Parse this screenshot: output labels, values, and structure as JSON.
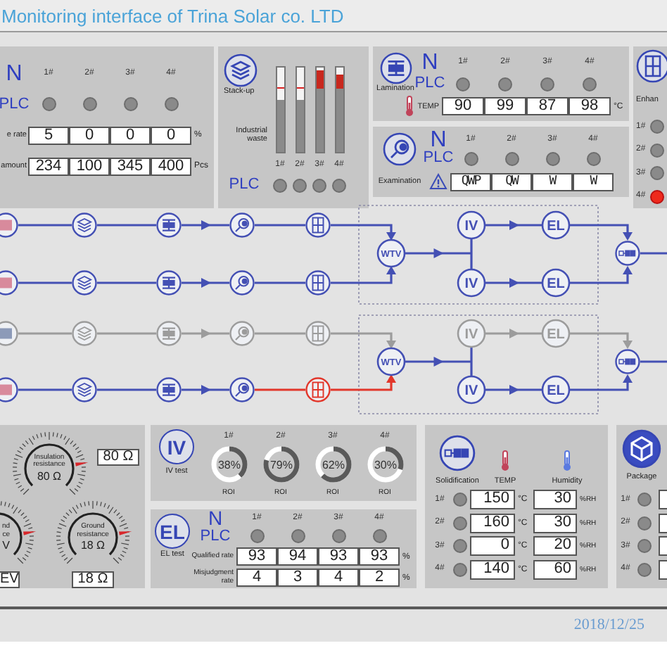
{
  "header": {
    "title": "Monitoring interface of Trina Solar co. LTD"
  },
  "production": {
    "n_label": "N",
    "plc_label": "PLC",
    "stations": [
      {
        "label": "1#",
        "alarm": false
      },
      {
        "label": "2#",
        "alarm": false
      },
      {
        "label": "3#",
        "alarm": false
      },
      {
        "label": "4#",
        "alarm": false
      }
    ],
    "rows": [
      {
        "label": "e rate",
        "values": [
          "5",
          "0",
          "0",
          "0"
        ],
        "unit": "%"
      },
      {
        "label": "amount",
        "values": [
          "234",
          "100",
          "345",
          "400"
        ],
        "unit": "Pcs"
      }
    ]
  },
  "stack_up": {
    "label": "Stack-up",
    "waste_label": "Industrial waste",
    "bins": [
      {
        "label": "1#",
        "level": 0.62
      },
      {
        "label": "2#",
        "level": 0.62
      },
      {
        "label": "3#",
        "level": 0.97
      },
      {
        "label": "4#",
        "level": 0.92
      }
    ],
    "plc_label": "PLC",
    "stations": [
      {
        "alarm": false
      },
      {
        "alarm": false
      },
      {
        "alarm": false
      },
      {
        "alarm": false
      }
    ]
  },
  "lamination": {
    "label": "Lamination",
    "n_label": "N",
    "plc_label": "PLC",
    "stations": [
      {
        "label": "1#",
        "alarm": false
      },
      {
        "label": "2#",
        "alarm": false
      },
      {
        "label": "3#",
        "alarm": false
      },
      {
        "label": "4#",
        "alarm": false
      }
    ],
    "temp_label": "TEMP",
    "temps": [
      "90",
      "99",
      "87",
      "98"
    ],
    "unit": "°C"
  },
  "examination": {
    "label": "Examination",
    "n_label": "N",
    "plc_label": "PLC",
    "stations": [
      {
        "label": "1#",
        "alarm": false
      },
      {
        "label": "2#",
        "alarm": false
      },
      {
        "label": "3#",
        "alarm": false
      },
      {
        "label": "4#",
        "alarm": false
      }
    ],
    "results": [
      "QWP",
      "QW",
      "W",
      "W"
    ]
  },
  "enhance": {
    "label": "Enhan",
    "stations": [
      {
        "label": "1#",
        "alarm": false
      },
      {
        "label": "2#",
        "alarm": false
      },
      {
        "label": "3#",
        "alarm": false
      },
      {
        "label": "4#",
        "alarm": true
      }
    ]
  },
  "flow_groups": [
    {
      "junction_label": "WTV",
      "running": true,
      "lines": [
        {
          "running": true,
          "fault": false,
          "iv_label": "IV",
          "el_label": "EL"
        },
        {
          "running": true,
          "fault": false,
          "iv_label": "IV",
          "el_label": "EL"
        }
      ]
    },
    {
      "junction_label": "WTV",
      "running": true,
      "lines": [
        {
          "running": false,
          "fault": false,
          "iv_label": "IV",
          "el_label": "EL"
        },
        {
          "running": true,
          "fault": true,
          "iv_label": "IV",
          "el_label": "EL"
        }
      ]
    }
  ],
  "resistance": {
    "gauges": [
      {
        "kind": "full",
        "label": "Insulation resistance",
        "reading": "80 Ω",
        "value": "80 Ω"
      },
      {
        "kind": "cut",
        "label": "nd ce",
        "reading": "V",
        "value": "EV"
      },
      {
        "kind": "full",
        "label": "Ground resistance",
        "reading": "18 Ω",
        "value": "18 Ω"
      }
    ]
  },
  "iv_test": {
    "badge": "IV",
    "label": "IV test",
    "tests": [
      {
        "label": "1#",
        "reading": "38%",
        "level": 0.38,
        "caption": "ROI"
      },
      {
        "label": "2#",
        "reading": "79%",
        "level": 0.79,
        "caption": "ROI"
      },
      {
        "label": "3#",
        "reading": "62%",
        "level": 0.62,
        "caption": "ROI"
      },
      {
        "label": "4#",
        "reading": "30%",
        "level": 0.3,
        "caption": "ROI"
      }
    ]
  },
  "el_test": {
    "badge": "EL",
    "label": "EL test",
    "n_label": "N",
    "plc_label": "PLC",
    "stations": [
      {
        "label": "1#",
        "alarm": false
      },
      {
        "label": "2#",
        "alarm": false
      },
      {
        "label": "3#",
        "alarm": false
      },
      {
        "label": "4#",
        "alarm": false
      }
    ],
    "rows": [
      {
        "label": "Qualified rate",
        "values": [
          "93",
          "94",
          "93",
          "93"
        ],
        "unit": "%"
      },
      {
        "label": "Misjudgment rate",
        "values": [
          "4",
          "3",
          "4",
          "2"
        ],
        "unit": "%"
      }
    ]
  },
  "solidification": {
    "label": "Solidification",
    "temp_label": "TEMP",
    "humidity_label": "Humidity",
    "rows": [
      {
        "label": "1#",
        "alarm": false,
        "temp": "150",
        "temp_unit": "°C",
        "humidity": "30",
        "humidity_unit": "%RH"
      },
      {
        "label": "2#",
        "alarm": false,
        "temp": "160",
        "temp_unit": "°C",
        "humidity": "30",
        "humidity_unit": "%RH"
      },
      {
        "label": "3#",
        "alarm": false,
        "temp": "0",
        "temp_unit": "°C",
        "humidity": "20",
        "humidity_unit": "%RH"
      },
      {
        "label": "4#",
        "alarm": false,
        "temp": "140",
        "temp_unit": "°C",
        "humidity": "60",
        "humidity_unit": "%RH"
      }
    ]
  },
  "package": {
    "label": "Package",
    "stations": [
      {
        "label": "1#",
        "alarm": false
      },
      {
        "label": "2#",
        "alarm": false
      },
      {
        "label": "3#",
        "alarm": false
      },
      {
        "label": "4#",
        "alarm": false
      }
    ]
  },
  "footer": {
    "date": "2018/12/25"
  }
}
